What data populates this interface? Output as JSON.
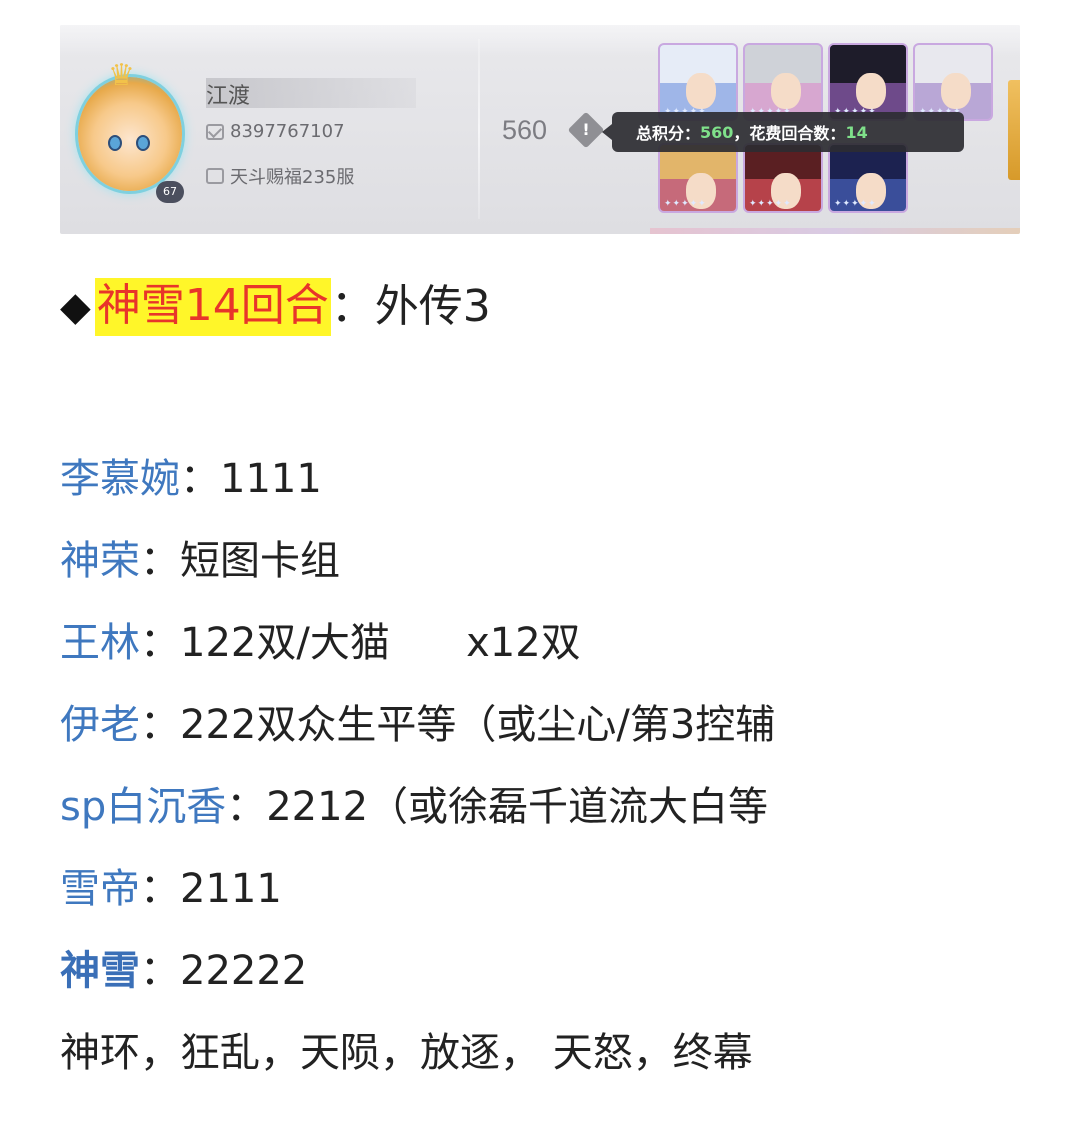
{
  "banner": {
    "player_name": "江渡",
    "player_id": "8397767107",
    "server": "天斗赐福235服",
    "level": "67",
    "score": "560",
    "tooltip": {
      "score_label": "总积分：",
      "score_value": "560",
      "sep": "，花费回合数：",
      "rounds_value": "14"
    },
    "card_colors": [
      "#9fb6e8",
      "#d7a7d0",
      "#6e4a8a",
      "#b9a7d6",
      "#c66a7a",
      "#b6424a",
      "#3a4e9a"
    ],
    "icons": [
      "mail-icon",
      "server-icon",
      "info-icon"
    ]
  },
  "heading": {
    "bullet": "◆",
    "highlight": "神雪14回合",
    "colon": "：",
    "rest": "外传3"
  },
  "lines": [
    {
      "label": "李慕婉",
      "sep": "：",
      "value": "1111"
    },
    {
      "label": "神荣",
      "sep": "：",
      "value": "短图卡组"
    },
    {
      "label": "王林",
      "sep": "：",
      "value": "122双/大猫      x12双"
    },
    {
      "label": "伊老",
      "sep": "：",
      "value": "222双众生平等（或尘心/第3控辅"
    },
    {
      "label": "sp白沉香",
      "sep": "：",
      "value": "2212（或徐磊千道流大白等"
    },
    {
      "label": "雪帝",
      "sep": "：",
      "value": "2111"
    },
    {
      "label": "神雪",
      "sep": "：",
      "value": "22222"
    }
  ],
  "footer_line": "神环，狂乱，天陨，放逐， 天怒，终幕",
  "colors": {
    "label_blue": "#3f78bf",
    "highlight_bg": "#fff629",
    "highlight_text": "#e8352a",
    "tooltip_green": "#7fe08a"
  }
}
